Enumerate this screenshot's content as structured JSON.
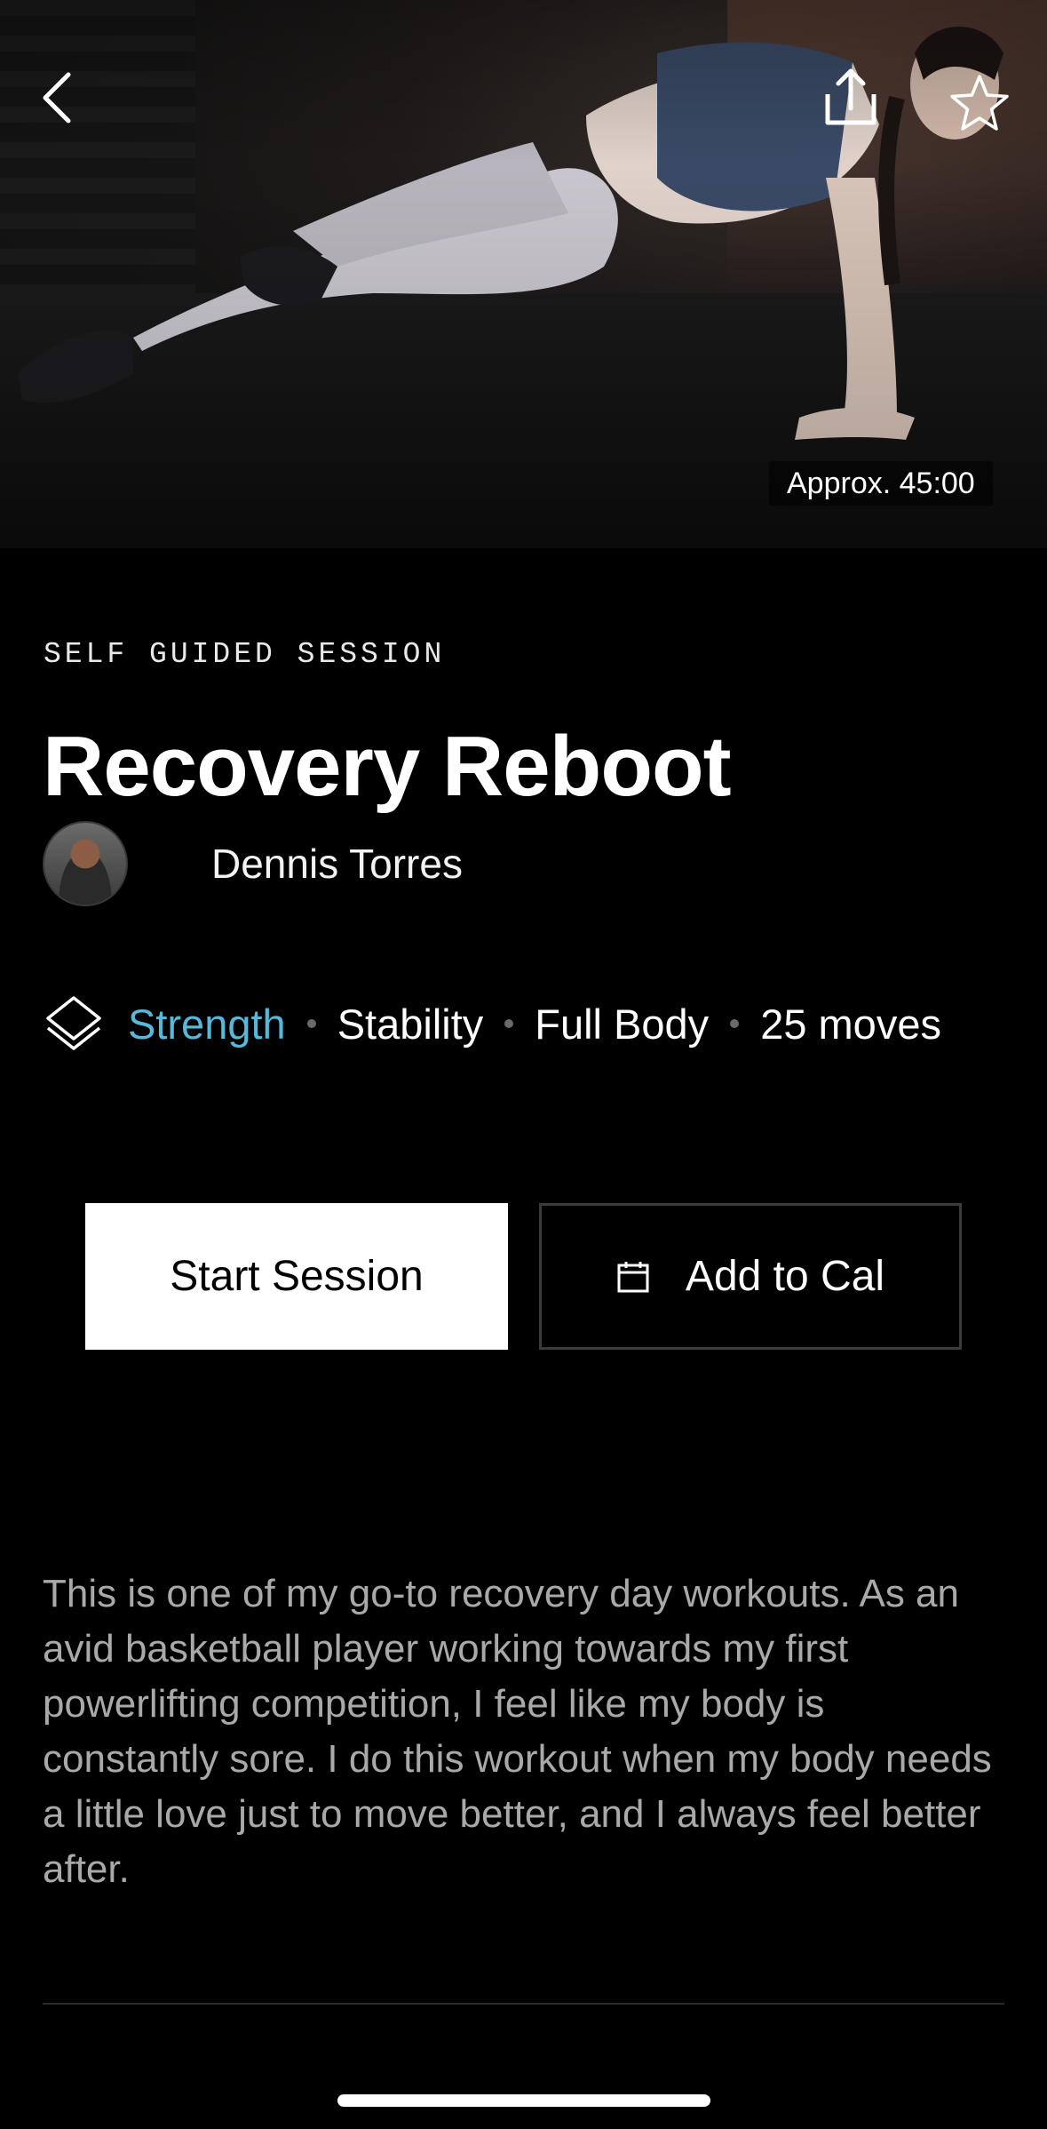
{
  "hero": {
    "duration_label": "Approx. 45:00"
  },
  "session": {
    "eyebrow": "SELF GUIDED SESSION",
    "title": "Recovery Reboot",
    "instructor": "Dennis Torres",
    "tags": [
      "Strength",
      "Stability",
      "Full Body",
      "25 moves"
    ],
    "accent_color": "#57b8d9",
    "description": "This is one of my go-to recovery day workouts. As an avid basketball player working towards my first powerlifting competition, I feel like my body is constantly sore. I do this workout when my body needs a little love just to move better, and I always feel better after."
  },
  "actions": {
    "start_label": "Start Session",
    "calendar_label": "Add to Cal"
  },
  "icons": {
    "back": "chevron-left-icon",
    "share": "share-icon",
    "favorite": "star-icon",
    "category": "layers-icon",
    "calendar": "calendar-icon"
  }
}
